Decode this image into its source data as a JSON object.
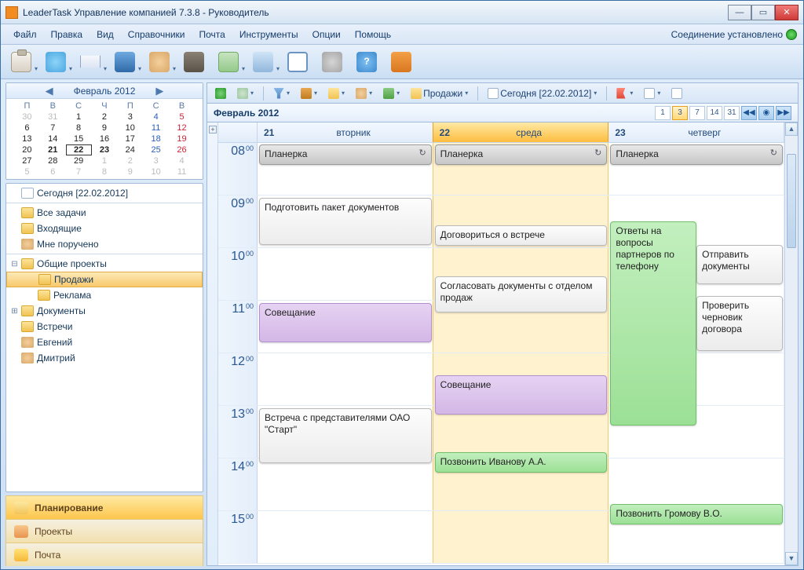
{
  "window": {
    "title": "LeaderTask Управление компанией 7.3.8 - Руководитель"
  },
  "menu": {
    "items": [
      "Файл",
      "Правка",
      "Вид",
      "Справочники",
      "Почта",
      "Инструменты",
      "Опции",
      "Помощь"
    ],
    "connection": "Соединение установлено"
  },
  "miniCal": {
    "label": "Февраль 2012",
    "dow": [
      "П",
      "В",
      "С",
      "Ч",
      "П",
      "С",
      "В"
    ],
    "weeks": [
      [
        {
          "d": "30",
          "cls": "gray"
        },
        {
          "d": "31",
          "cls": "gray"
        },
        {
          "d": "1"
        },
        {
          "d": "2"
        },
        {
          "d": "3"
        },
        {
          "d": "4",
          "cls": "sat"
        },
        {
          "d": "5",
          "cls": "sun"
        }
      ],
      [
        {
          "d": "6"
        },
        {
          "d": "7"
        },
        {
          "d": "8"
        },
        {
          "d": "9"
        },
        {
          "d": "10"
        },
        {
          "d": "11",
          "cls": "sat"
        },
        {
          "d": "12",
          "cls": "sun"
        }
      ],
      [
        {
          "d": "13"
        },
        {
          "d": "14"
        },
        {
          "d": "15"
        },
        {
          "d": "16"
        },
        {
          "d": "17"
        },
        {
          "d": "18",
          "cls": "sat"
        },
        {
          "d": "19",
          "cls": "sun"
        }
      ],
      [
        {
          "d": "20"
        },
        {
          "d": "21",
          "cls": "bold"
        },
        {
          "d": "22",
          "cls": "today bold"
        },
        {
          "d": "23",
          "cls": "bold"
        },
        {
          "d": "24"
        },
        {
          "d": "25",
          "cls": "sat"
        },
        {
          "d": "26",
          "cls": "sun"
        }
      ],
      [
        {
          "d": "27"
        },
        {
          "d": "28"
        },
        {
          "d": "29"
        },
        {
          "d": "1",
          "cls": "gray"
        },
        {
          "d": "2",
          "cls": "gray"
        },
        {
          "d": "3",
          "cls": "gray"
        },
        {
          "d": "4",
          "cls": "gray"
        }
      ],
      [
        {
          "d": "5",
          "cls": "gray"
        },
        {
          "d": "6",
          "cls": "gray"
        },
        {
          "d": "7",
          "cls": "gray"
        },
        {
          "d": "8",
          "cls": "gray"
        },
        {
          "d": "9",
          "cls": "gray"
        },
        {
          "d": "10",
          "cls": "gray"
        },
        {
          "d": "11",
          "cls": "gray"
        }
      ]
    ]
  },
  "tree": {
    "today": "Сегодня [22.02.2012]",
    "items": {
      "all": "Все задачи",
      "inbox": "Входящие",
      "assigned": "Мне поручено",
      "shared": "Общие проекты",
      "sales": "Продажи",
      "ads": "Реклама",
      "docs": "Документы",
      "meet": "Встречи",
      "evg": "Евгений",
      "dmi": "Дмитрий"
    }
  },
  "tabs": {
    "plan": "Планирование",
    "proj": "Проекты",
    "mail": "Почта"
  },
  "filter": {
    "crumb_folder": "Продажи",
    "crumb_today": "Сегодня [22.02.2012]"
  },
  "period": {
    "label": "Февраль 2012",
    "views": [
      "1",
      "3",
      "7",
      "14",
      "31"
    ]
  },
  "days": [
    {
      "num": "21",
      "name": "вторник"
    },
    {
      "num": "22",
      "name": "среда"
    },
    {
      "num": "23",
      "name": "четверг"
    }
  ],
  "hours": [
    "08",
    "09",
    "10",
    "11",
    "12",
    "13",
    "14",
    "15"
  ],
  "mm": "00",
  "events": {
    "d0": {
      "e1": "Планерка",
      "e2": "Подготовить пакет документов",
      "e3": "Совещание",
      "e4": "Встреча с представителями ОАО \"Старт\""
    },
    "d1": {
      "e1": "Планерка",
      "e2": "Договориться о встрече",
      "e3": "Согласовать документы с отделом продаж",
      "e4": "Совещание",
      "e5": "Позвонить Иванову А.А."
    },
    "d2": {
      "e1": "Планерка",
      "e2": "Ответы на вопросы партнеров по телефону",
      "e3": "Отправить документы",
      "e4": "Проверить черновик договора",
      "e5": "Позвонить Громову В.О."
    }
  },
  "recurring": "↻"
}
